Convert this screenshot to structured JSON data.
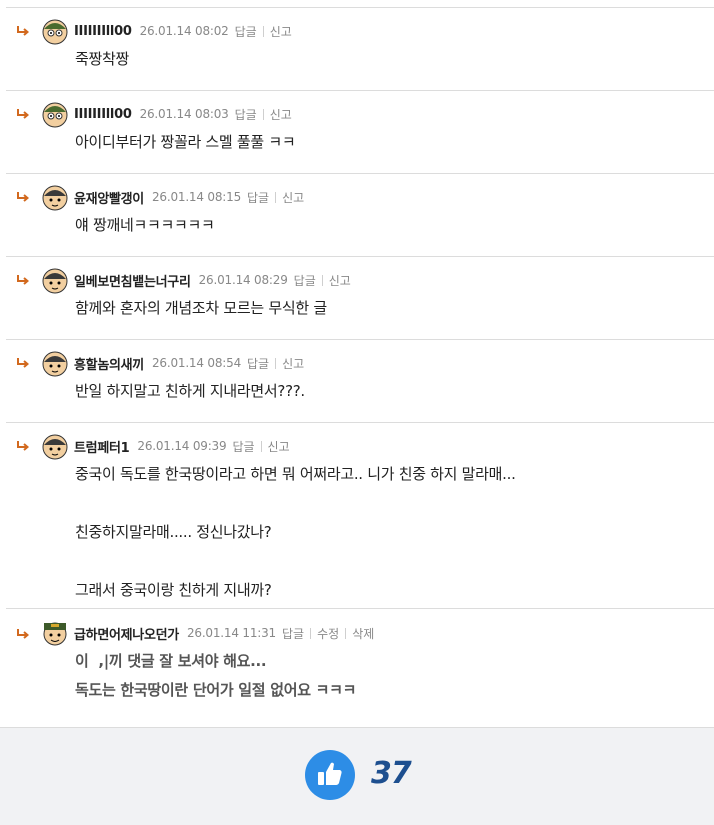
{
  "comments": [
    {
      "nick": "IIIIIIIll00",
      "date": "26.01.14 08:02",
      "actions": [
        "답글",
        "신고"
      ],
      "body": "죽짱착짱"
    },
    {
      "nick": "IIIIIIIll00",
      "date": "26.01.14 08:03",
      "actions": [
        "답글",
        "신고"
      ],
      "body": "아이디부터가 짱꼴라 스멜 풀풀 ㅋㅋ"
    },
    {
      "nick": "윤재앙빨갱이",
      "date": "26.01.14 08:15",
      "actions": [
        "답글",
        "신고"
      ],
      "body": "얘 짱깨네ㅋㅋㅋㅋㅋㅋ"
    },
    {
      "nick": "일베보면침뱉는너구리",
      "date": "26.01.14 08:29",
      "actions": [
        "답글",
        "신고"
      ],
      "body": "함께와 혼자의 개념조차 모르는 무식한 글"
    },
    {
      "nick": "흥할놈의새끼",
      "date": "26.01.14 08:54",
      "actions": [
        "답글",
        "신고"
      ],
      "body": "반일 하지말고 친하게 지내라면서???."
    },
    {
      "nick": "트럼페터1",
      "date": "26.01.14 09:39",
      "actions": [
        "답글",
        "신고"
      ],
      "body": "중국이 독도를 한국땅이라고 하면 뭐 어쩌라고.. 니가 친중 하지 말라매...\n\n친중하지말라매..... 정신나갔나?\n\n그래서 중국이랑 친하게 지내까?"
    },
    {
      "nick": "급하면어제나오던가",
      "date": "26.01.14 11:31",
      "actions": [
        "답글",
        "수정",
        "삭제"
      ],
      "body": "이  ,|끼 댓글 잘 보셔야 해요...\n독도는 한국땅이란 단어가 일절 없어요 ㅋㅋㅋ"
    }
  ],
  "like": {
    "count": "37",
    "icon": "thumbs-up-icon"
  },
  "colors": {
    "accent": "#2d8de6",
    "count": "#1d4f8f",
    "reply_arrow": "#d2691e",
    "footer_bg": "#f1f2f4"
  }
}
